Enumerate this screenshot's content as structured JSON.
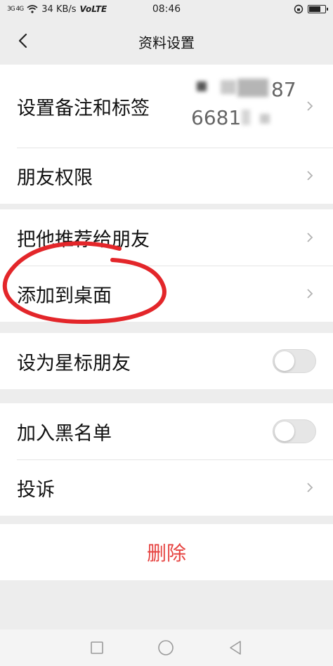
{
  "status_bar": {
    "signal": "3G 4G",
    "speed": "34 KB/s",
    "network": "VoLTE",
    "time": "08:46"
  },
  "nav": {
    "title": "资料设置",
    "back_icon": "chevron-left-icon"
  },
  "groups": [
    {
      "items": [
        {
          "label": "设置备注和标签",
          "remark_line1": "87",
          "remark_line2": "6681",
          "type": "link"
        },
        {
          "label": "朋友权限",
          "type": "link"
        }
      ]
    },
    {
      "items": [
        {
          "label": "把他推荐给朋友",
          "type": "link"
        },
        {
          "label": "添加到桌面",
          "type": "link"
        }
      ]
    },
    {
      "items": [
        {
          "label": "设为星标朋友",
          "type": "toggle",
          "on": false
        }
      ]
    },
    {
      "items": [
        {
          "label": "加入黑名单",
          "type": "toggle",
          "on": false
        },
        {
          "label": "投诉",
          "type": "link"
        }
      ]
    }
  ],
  "delete_label": "删除",
  "colors": {
    "background": "#ededed",
    "delete_text": "#e64340",
    "annotation_circle": "#e3262a"
  },
  "system_nav": [
    "square-icon",
    "circle-icon",
    "triangle-back-icon"
  ]
}
